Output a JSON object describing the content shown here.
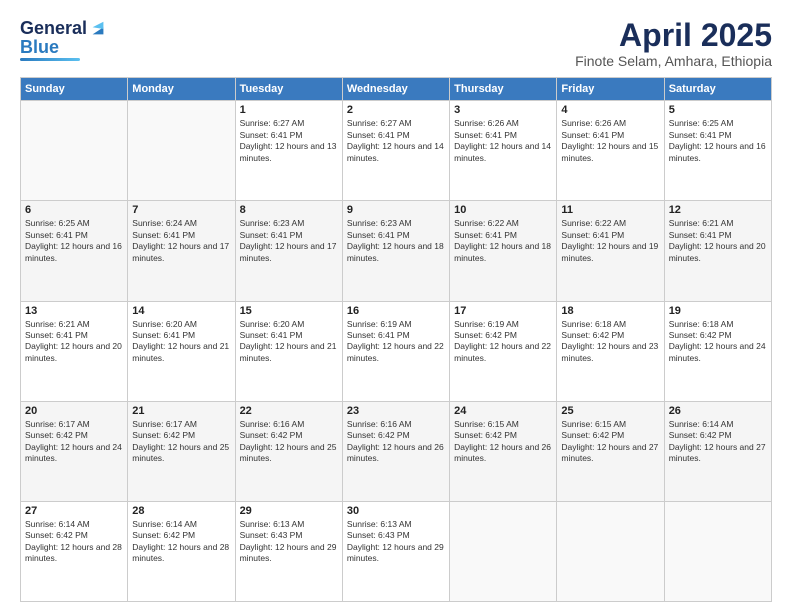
{
  "header": {
    "logo_general": "General",
    "logo_blue": "Blue",
    "title": "April 2025",
    "location": "Finote Selam, Amhara, Ethiopia"
  },
  "weekdays": [
    "Sunday",
    "Monday",
    "Tuesday",
    "Wednesday",
    "Thursday",
    "Friday",
    "Saturday"
  ],
  "weeks": [
    [
      {
        "day": "",
        "info": ""
      },
      {
        "day": "",
        "info": ""
      },
      {
        "day": "1",
        "info": "Sunrise: 6:27 AM\nSunset: 6:41 PM\nDaylight: 12 hours and 13 minutes."
      },
      {
        "day": "2",
        "info": "Sunrise: 6:27 AM\nSunset: 6:41 PM\nDaylight: 12 hours and 14 minutes."
      },
      {
        "day": "3",
        "info": "Sunrise: 6:26 AM\nSunset: 6:41 PM\nDaylight: 12 hours and 14 minutes."
      },
      {
        "day": "4",
        "info": "Sunrise: 6:26 AM\nSunset: 6:41 PM\nDaylight: 12 hours and 15 minutes."
      },
      {
        "day": "5",
        "info": "Sunrise: 6:25 AM\nSunset: 6:41 PM\nDaylight: 12 hours and 16 minutes."
      }
    ],
    [
      {
        "day": "6",
        "info": "Sunrise: 6:25 AM\nSunset: 6:41 PM\nDaylight: 12 hours and 16 minutes."
      },
      {
        "day": "7",
        "info": "Sunrise: 6:24 AM\nSunset: 6:41 PM\nDaylight: 12 hours and 17 minutes."
      },
      {
        "day": "8",
        "info": "Sunrise: 6:23 AM\nSunset: 6:41 PM\nDaylight: 12 hours and 17 minutes."
      },
      {
        "day": "9",
        "info": "Sunrise: 6:23 AM\nSunset: 6:41 PM\nDaylight: 12 hours and 18 minutes."
      },
      {
        "day": "10",
        "info": "Sunrise: 6:22 AM\nSunset: 6:41 PM\nDaylight: 12 hours and 18 minutes."
      },
      {
        "day": "11",
        "info": "Sunrise: 6:22 AM\nSunset: 6:41 PM\nDaylight: 12 hours and 19 minutes."
      },
      {
        "day": "12",
        "info": "Sunrise: 6:21 AM\nSunset: 6:41 PM\nDaylight: 12 hours and 20 minutes."
      }
    ],
    [
      {
        "day": "13",
        "info": "Sunrise: 6:21 AM\nSunset: 6:41 PM\nDaylight: 12 hours and 20 minutes."
      },
      {
        "day": "14",
        "info": "Sunrise: 6:20 AM\nSunset: 6:41 PM\nDaylight: 12 hours and 21 minutes."
      },
      {
        "day": "15",
        "info": "Sunrise: 6:20 AM\nSunset: 6:41 PM\nDaylight: 12 hours and 21 minutes."
      },
      {
        "day": "16",
        "info": "Sunrise: 6:19 AM\nSunset: 6:41 PM\nDaylight: 12 hours and 22 minutes."
      },
      {
        "day": "17",
        "info": "Sunrise: 6:19 AM\nSunset: 6:42 PM\nDaylight: 12 hours and 22 minutes."
      },
      {
        "day": "18",
        "info": "Sunrise: 6:18 AM\nSunset: 6:42 PM\nDaylight: 12 hours and 23 minutes."
      },
      {
        "day": "19",
        "info": "Sunrise: 6:18 AM\nSunset: 6:42 PM\nDaylight: 12 hours and 24 minutes."
      }
    ],
    [
      {
        "day": "20",
        "info": "Sunrise: 6:17 AM\nSunset: 6:42 PM\nDaylight: 12 hours and 24 minutes."
      },
      {
        "day": "21",
        "info": "Sunrise: 6:17 AM\nSunset: 6:42 PM\nDaylight: 12 hours and 25 minutes."
      },
      {
        "day": "22",
        "info": "Sunrise: 6:16 AM\nSunset: 6:42 PM\nDaylight: 12 hours and 25 minutes."
      },
      {
        "day": "23",
        "info": "Sunrise: 6:16 AM\nSunset: 6:42 PM\nDaylight: 12 hours and 26 minutes."
      },
      {
        "day": "24",
        "info": "Sunrise: 6:15 AM\nSunset: 6:42 PM\nDaylight: 12 hours and 26 minutes."
      },
      {
        "day": "25",
        "info": "Sunrise: 6:15 AM\nSunset: 6:42 PM\nDaylight: 12 hours and 27 minutes."
      },
      {
        "day": "26",
        "info": "Sunrise: 6:14 AM\nSunset: 6:42 PM\nDaylight: 12 hours and 27 minutes."
      }
    ],
    [
      {
        "day": "27",
        "info": "Sunrise: 6:14 AM\nSunset: 6:42 PM\nDaylight: 12 hours and 28 minutes."
      },
      {
        "day": "28",
        "info": "Sunrise: 6:14 AM\nSunset: 6:42 PM\nDaylight: 12 hours and 28 minutes."
      },
      {
        "day": "29",
        "info": "Sunrise: 6:13 AM\nSunset: 6:43 PM\nDaylight: 12 hours and 29 minutes."
      },
      {
        "day": "30",
        "info": "Sunrise: 6:13 AM\nSunset: 6:43 PM\nDaylight: 12 hours and 29 minutes."
      },
      {
        "day": "",
        "info": ""
      },
      {
        "day": "",
        "info": ""
      },
      {
        "day": "",
        "info": ""
      }
    ]
  ]
}
